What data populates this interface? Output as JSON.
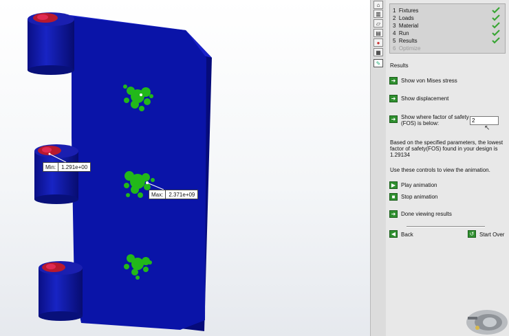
{
  "probes": {
    "min_label": "Min:",
    "min_value": "1.291e+00",
    "max_label": "Max:",
    "max_value": "2.371e+09"
  },
  "toolstrip": {
    "icons": [
      "home-icon",
      "parts-icon",
      "folder-icon",
      "properties-icon",
      "appearance-icon",
      "display-icon",
      "simulation-expert-icon"
    ]
  },
  "steps": [
    {
      "num": "1",
      "label": "Fixtures",
      "done": true
    },
    {
      "num": "2",
      "label": "Loads",
      "done": true
    },
    {
      "num": "3",
      "label": "Material",
      "done": true
    },
    {
      "num": "4",
      "label": "Run",
      "done": true
    },
    {
      "num": "5",
      "label": "Results",
      "done": true
    },
    {
      "num": "6",
      "label": "Optimize",
      "done": false
    }
  ],
  "results": {
    "heading": "Results",
    "von_mises": "Show von Mises stress",
    "displacement": "Show displacement",
    "fos_line1": "Show where factor of safety",
    "fos_line2": "(FOS) is below:",
    "fos_value": "2",
    "summary_line1": "Based on the specified parameters, the lowest",
    "summary_line2": "factor of safety(FOS) found in your design is",
    "summary_line3": "1.29134",
    "animation_hint": "Use these controls to view the animation.",
    "play": "Play animation",
    "stop": "Stop animation",
    "done": "Done viewing results"
  },
  "nav": {
    "back": "Back",
    "start_over": "Start Over"
  },
  "colors": {
    "plate": "#0a14a8",
    "low_fos": "#22b81a",
    "check": "#3aa635",
    "button": "#2f8f2f"
  }
}
